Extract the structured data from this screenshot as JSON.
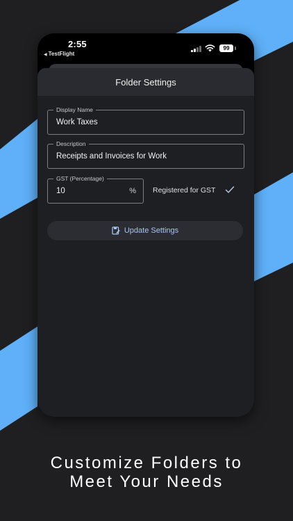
{
  "status_bar": {
    "time": "2:55",
    "back_app": "TestFlight",
    "battery": "99"
  },
  "sheet": {
    "title": "Folder Settings"
  },
  "form": {
    "display_name": {
      "label": "Display Name",
      "value": "Work Taxes"
    },
    "description": {
      "label": "Description",
      "value": "Receipts and Invoices for Work"
    },
    "gst": {
      "label": "GST (Percentage)",
      "value": "10",
      "suffix": "%"
    },
    "gst_registered": {
      "label": "Registered for GST",
      "checked": true
    }
  },
  "actions": {
    "update_label": "Update Settings"
  },
  "caption": {
    "line1": "Customize Folders to",
    "line2": "Meet Your Needs"
  },
  "colors": {
    "background": "#1f1f21",
    "stripe": "#5fb0f8",
    "accent": "#a8c4f0"
  }
}
